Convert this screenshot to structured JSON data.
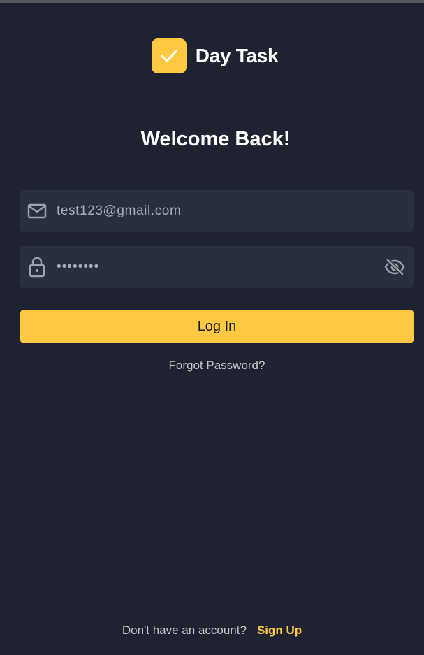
{
  "brand": {
    "name": "Day Task",
    "logo_icon": "check-icon"
  },
  "title": "Welcome Back!",
  "email_field": {
    "icon": "mail-icon",
    "value": "test123@gmail.com"
  },
  "password_field": {
    "icon": "lock-icon",
    "value": "••••••••",
    "toggle_icon": "eye-off-icon"
  },
  "login_button": {
    "label": "Log In"
  },
  "forgot_password": "Forgot Password?",
  "footer": {
    "question": "Don't have an account?",
    "signup_label": "Sign Up"
  },
  "colors": {
    "background": "#1f2231",
    "field": "#2a2f40",
    "accent": "#fec941",
    "text": "#ffffff"
  }
}
